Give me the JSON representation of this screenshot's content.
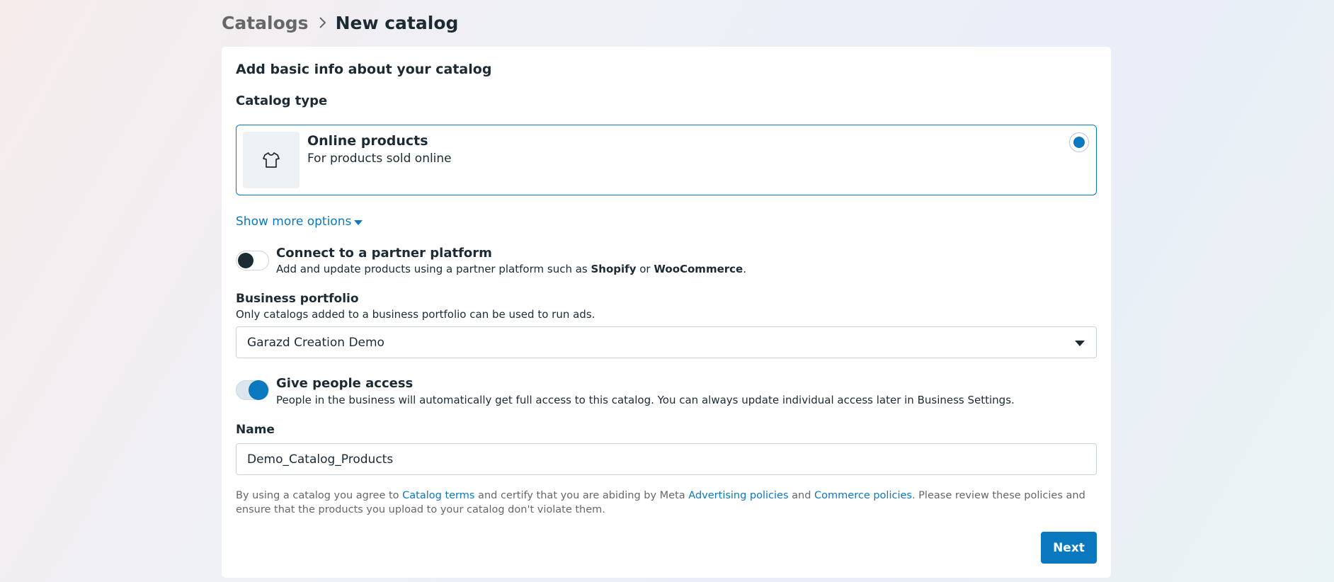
{
  "breadcrumb": {
    "root": "Catalogs",
    "current": "New catalog"
  },
  "card": {
    "title": "Add basic info about your catalog",
    "catalog_type_label": "Catalog type",
    "catalog_type": {
      "title": "Online products",
      "subtitle": "For products sold online",
      "icon": "tshirt-icon",
      "selected": true
    },
    "show_more": "Show more options",
    "partner": {
      "title": "Connect to a partner platform",
      "desc_prefix": "Add and update products using a partner platform such as ",
      "shopify": "Shopify",
      "or": " or ",
      "woocommerce": "WooCommerce",
      "desc_suffix": ".",
      "enabled": false
    },
    "business_portfolio": {
      "label": "Business portfolio",
      "helper": "Only catalogs added to a business portfolio can be used to run ads.",
      "selected": "Garazd Creation Demo"
    },
    "access": {
      "title": "Give people access",
      "desc": "People in the business will automatically get full access to this catalog. You can always update individual access later in Business Settings.",
      "enabled": true
    },
    "name": {
      "label": "Name",
      "value": "Demo_Catalog_Products"
    },
    "terms": {
      "part1": "By using a catalog you agree to ",
      "link1": "Catalog terms",
      "part2": " and certify that you are abiding by Meta ",
      "link2": "Advertising policies",
      "part3": " and ",
      "link3": "Commerce policies",
      "part4": ". Please review these policies and ensure that the products you upload to your catalog don't violate them."
    },
    "next_label": "Next"
  },
  "colors": {
    "accent": "#0a78be",
    "text": "#1c2b33",
    "muted": "#65676b"
  }
}
